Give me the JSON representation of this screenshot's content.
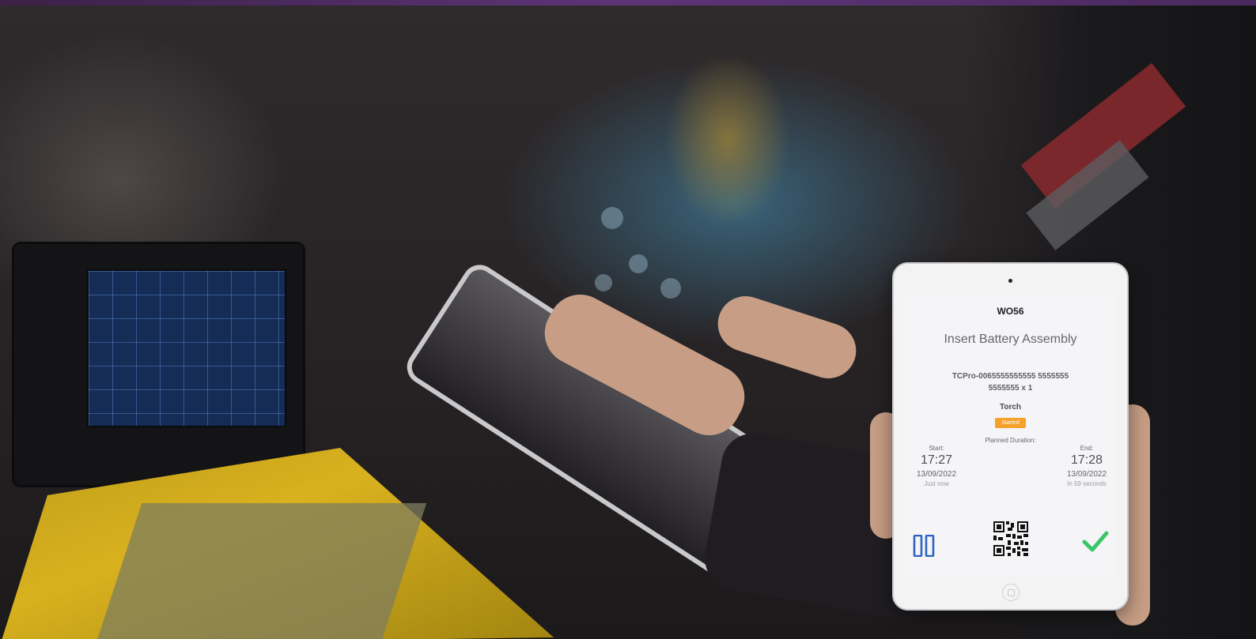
{
  "work_order": {
    "id": "WO56",
    "task_title": "Insert Battery Assembly",
    "product_code": "TCPro-0065555555555 5555555 5555555 x 1",
    "resource": "Torch",
    "status": "Started",
    "planned_duration_label": "Planned Duration:",
    "start": {
      "label": "Start:",
      "time": "17:27",
      "date": "13/09/2022",
      "relative": "Just now"
    },
    "end": {
      "label": "End:",
      "time": "17:28",
      "date": "13/09/2022",
      "relative": "In 59 seconds"
    }
  },
  "actions": {
    "pause_icon": "pause-icon",
    "qr_icon": "qr-code-icon",
    "complete_icon": "checkmark-icon"
  },
  "colors": {
    "status_badge": "#f5a12a",
    "pause": "#2e63c4",
    "complete": "#3cc56a",
    "top_band": "#5e3478"
  }
}
